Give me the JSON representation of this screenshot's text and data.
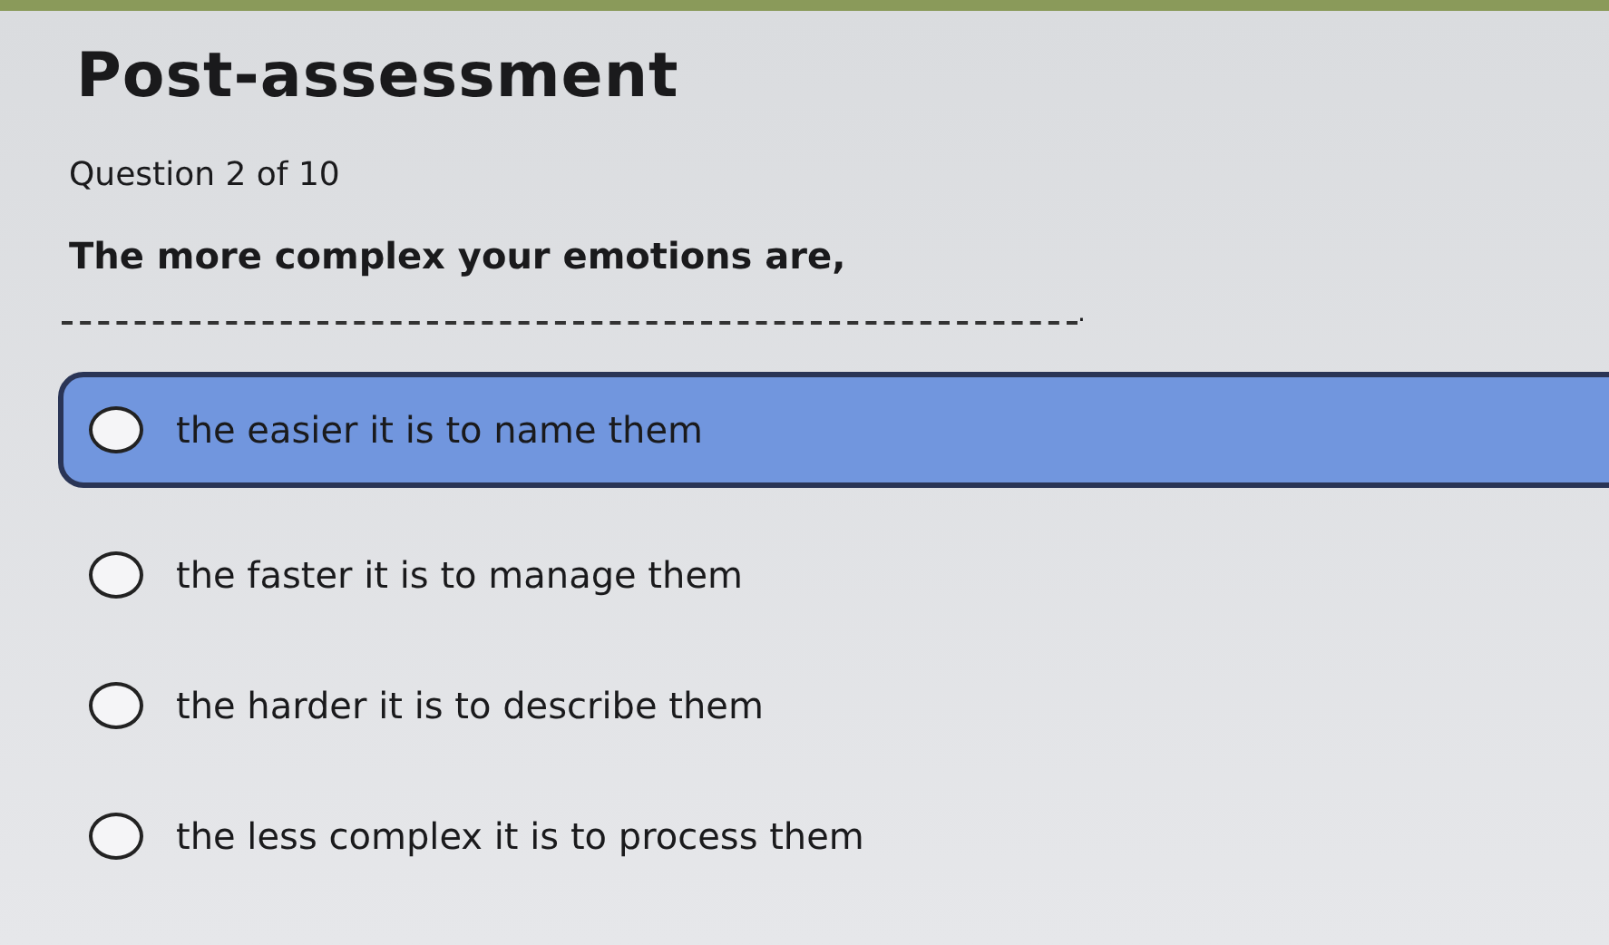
{
  "title": "Post-assessment",
  "progress": "Question 2 of 10",
  "question": {
    "text": "The more complex your emotions are,",
    "blank_end": "."
  },
  "options": [
    {
      "label": "the easier it is to name them",
      "selected": true
    },
    {
      "label": "the faster it is to manage them",
      "selected": false
    },
    {
      "label": "the harder it is to describe them",
      "selected": false
    },
    {
      "label": "the less complex it is to process them",
      "selected": false
    }
  ]
}
